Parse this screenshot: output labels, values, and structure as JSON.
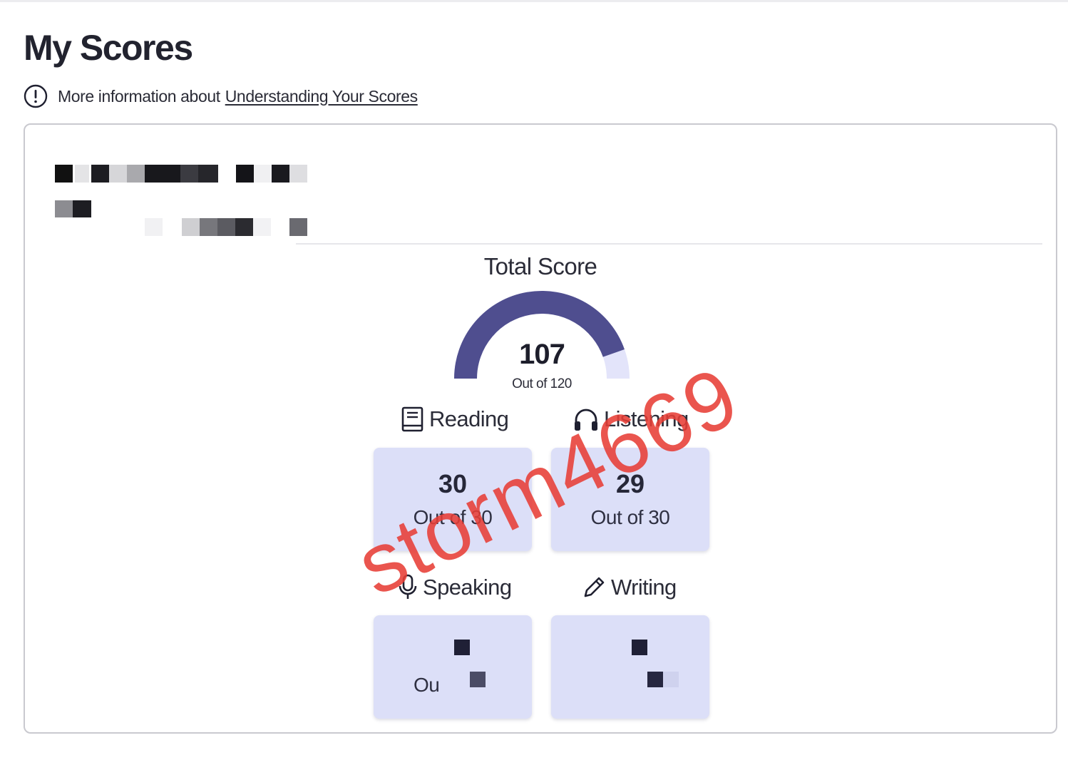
{
  "page": {
    "title": "My Scores"
  },
  "info": {
    "text": "More information about",
    "link_label": "Understanding Your Scores"
  },
  "total": {
    "label": "Total Score",
    "value": "107",
    "out_of": "Out of 120",
    "score": 107,
    "max": 120
  },
  "sections": {
    "reading": {
      "label": "Reading",
      "value": "30",
      "out_of": "Out of 30",
      "icon": "book-icon"
    },
    "listening": {
      "label": "Listening",
      "value": "29",
      "out_of": "Out of 30",
      "icon": "headphones-icon"
    },
    "speaking": {
      "label": "Speaking",
      "value": "",
      "out_of": "Ou",
      "icon": "microphone-icon"
    },
    "writing": {
      "label": "Writing",
      "value": "",
      "out_of": "",
      "icon": "pencil-icon"
    }
  },
  "watermark": {
    "text": "storm4669"
  },
  "colors": {
    "gauge_fill": "#4f4e8f",
    "gauge_track": "#e3e4fa",
    "tile_bg": "#dcdff8",
    "watermark": "#e73e36"
  }
}
